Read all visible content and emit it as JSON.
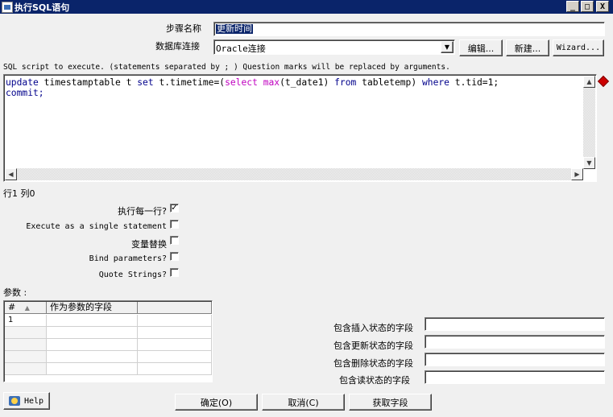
{
  "window": {
    "title": "执行SQL语句",
    "buttons": {
      "minimize": "_",
      "maximize": "□",
      "close": "X"
    }
  },
  "step_name": {
    "label": "步骤名称",
    "value": "更新时间"
  },
  "connection": {
    "label": "数据库连接",
    "value": "Oracle连接",
    "edit_button": "编辑...",
    "new_button": "新建...",
    "wizard_button": "Wizard..."
  },
  "script_hint": "SQL script to execute. (statements separated by ; ) Question marks will be replaced by arguments.",
  "editor": {
    "line1": {
      "p1": "update",
      "p2": " timestamptable t ",
      "p3": "set",
      "p4": " t.timetime=(",
      "p5": "select",
      "p6": " ",
      "p7": "max",
      "p8": "(t_date1) ",
      "p9": "from",
      "p10": " tabletemp) ",
      "p11": "where",
      "p12": " t.tid=1;"
    },
    "line2": "commit;"
  },
  "cursor_position": "行1 列0",
  "options": {
    "execute_each_row": {
      "label": "执行每一行?",
      "checked": true,
      "mark": "✓"
    },
    "single_statement": {
      "label": "Execute as a single statement",
      "checked": false
    },
    "variable_substitution": {
      "label": "变量替换",
      "checked": false
    },
    "bind_parameters": {
      "label": "Bind parameters?",
      "checked": false
    },
    "quote_strings": {
      "label": "Quote Strings?",
      "checked": false
    }
  },
  "params": {
    "label": "参数 :",
    "columns": [
      "#",
      "作为参数的字段",
      ""
    ],
    "sort_indicator": "▲",
    "rows": [
      {
        "index": "1",
        "field": ""
      }
    ]
  },
  "status_fields": {
    "insert": {
      "label": "包含插入状态的字段",
      "value": ""
    },
    "update": {
      "label": "包含更新状态的字段",
      "value": ""
    },
    "delete": {
      "label": "包含删除状态的字段",
      "value": ""
    },
    "read": {
      "label": "包含读状态的字段",
      "value": ""
    }
  },
  "footer": {
    "help": "Help",
    "ok": "确定(O)",
    "cancel": "取消(C)",
    "get_fields": "获取字段"
  },
  "colors": {
    "title_bar": "#0a246a",
    "keyword": "#00008b",
    "function": "#c000c0",
    "selection": "#0a246a"
  }
}
